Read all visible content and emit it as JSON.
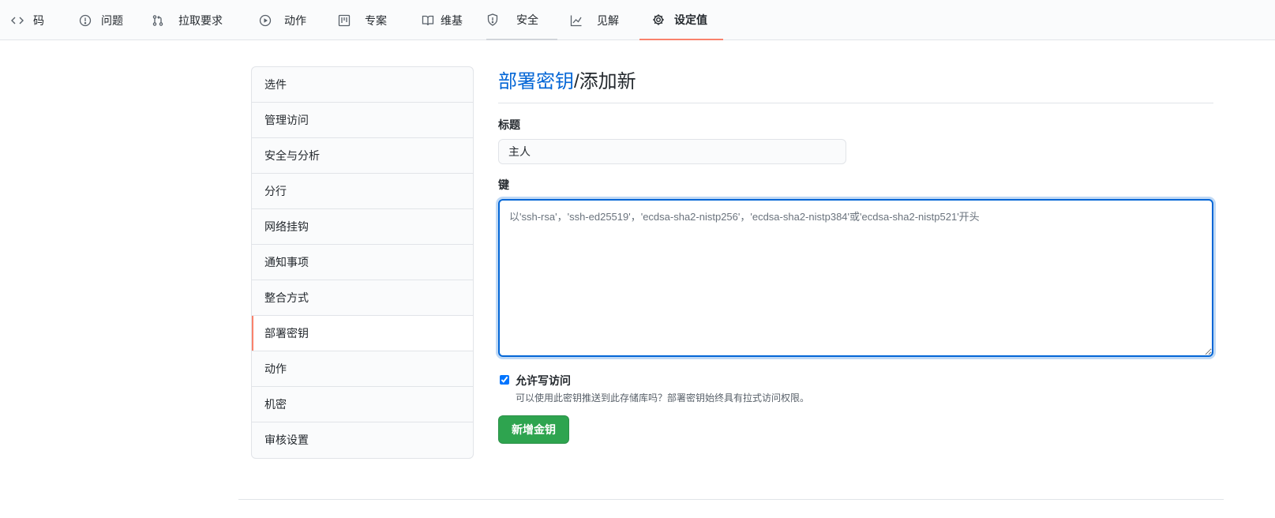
{
  "repo_nav": {
    "tabs": [
      {
        "label": "码",
        "icon": "code-icon"
      },
      {
        "label": "问题",
        "icon": "issue-opened-icon"
      },
      {
        "label": "拉取要求",
        "icon": "git-pull-request-icon"
      },
      {
        "label": "动作",
        "icon": "play-icon"
      },
      {
        "label": "专案",
        "icon": "project-icon"
      },
      {
        "label": "维基",
        "icon": "book-icon"
      },
      {
        "label": "安全",
        "icon": "shield-icon"
      },
      {
        "label": "见解",
        "icon": "graph-icon"
      },
      {
        "label": "设定值",
        "icon": "gear-icon"
      }
    ],
    "selected": "设定值",
    "accent_color": "#f9826c"
  },
  "sidebar": {
    "items": [
      {
        "label": "选件"
      },
      {
        "label": "管理访问"
      },
      {
        "label": "安全与分析"
      },
      {
        "label": "分行"
      },
      {
        "label": "网络挂钩"
      },
      {
        "label": "通知事项"
      },
      {
        "label": "整合方式"
      },
      {
        "label": "部署密钥"
      },
      {
        "label": "动作"
      },
      {
        "label": "机密"
      },
      {
        "label": "审核设置"
      }
    ],
    "selected": "部署密钥"
  },
  "main": {
    "breadcrumb_link": "部署密钥",
    "breadcrumb_current": "/添加新",
    "title_label": "标题",
    "title_value": "主人",
    "key_label": "键",
    "key_placeholder": "以'ssh-rsa'，'ssh-ed25519'，'ecdsa-sha2-nistp256'，'ecdsa-sha2-nistp384'或'ecdsa-sha2-nistp521'开头",
    "write_access_label": "允许写访问",
    "write_access_checked": true,
    "write_access_note": "可以使用此密钥推送到此存储库吗？部署密钥始终具有拉式访问权限。",
    "submit_label": "新增金钥",
    "submit_color": "#2ea44f",
    "link_color": "#0366d6"
  }
}
